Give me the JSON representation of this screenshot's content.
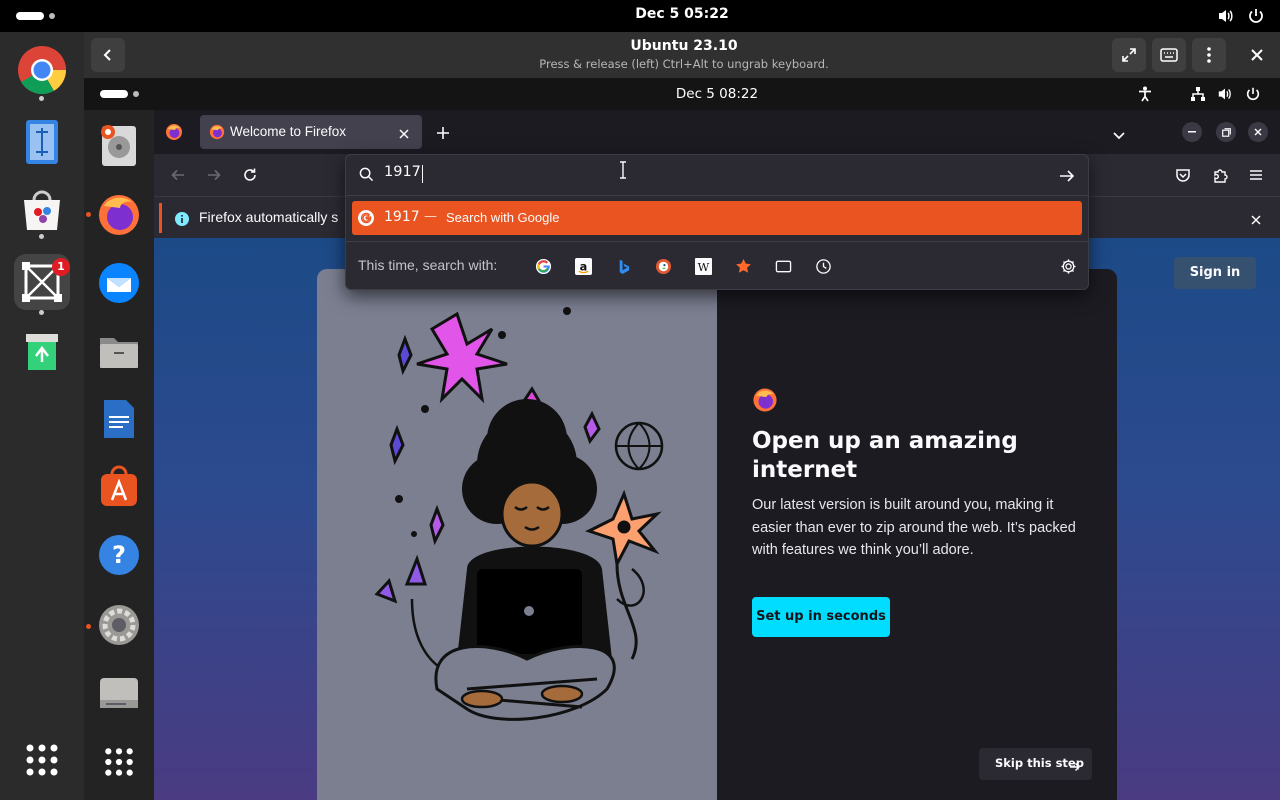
{
  "host": {
    "clock": "Dec 5  05:22",
    "dock": {
      "notification_badge": "1"
    }
  },
  "vm": {
    "title": "Ubuntu 23.10",
    "subtitle": "Press & release (left) Ctrl+Alt to ungrab keyboard."
  },
  "guest": {
    "clock": "Dec 5  08:22"
  },
  "firefox": {
    "tab_title": "Welcome to Firefox",
    "infobar_text": "Firefox automatically s",
    "urlbar": {
      "value": "1917",
      "suggestion_term": "1917",
      "suggestion_separator": "—",
      "suggestion_action": "Search with Google",
      "search_with_label": "This time, search with:",
      "engines": [
        "google-icon",
        "amazon-icon",
        "bing-icon",
        "duckduckgo-icon",
        "wikipedia-icon",
        "bookmarks-icon",
        "tabs-icon",
        "history-icon"
      ]
    },
    "page": {
      "sign_in": "Sign in",
      "heading": "Open up an amazing internet",
      "body": "Our latest version is built around you, making it easier than ever to zip around the web. It’s packed with features we think you’ll adore.",
      "cta": "Set up in seconds",
      "skip": "Skip this step"
    }
  },
  "colors": {
    "suggestion_highlight": "#e95420",
    "cta": "#00ddff",
    "ubuntu_orange": "#e95420"
  }
}
